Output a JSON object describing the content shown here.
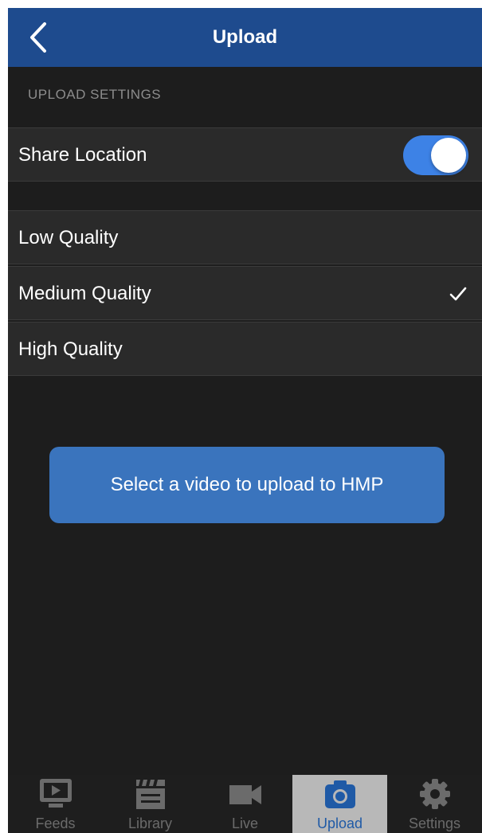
{
  "navbar": {
    "title": "Upload",
    "back_icon": "chevron-left-icon"
  },
  "section": {
    "header": "UPLOAD SETTINGS"
  },
  "share_location": {
    "label": "Share Location",
    "enabled": true
  },
  "quality": {
    "options": [
      {
        "label": "Low Quality",
        "selected": false
      },
      {
        "label": "Medium Quality",
        "selected": true
      },
      {
        "label": "High Quality",
        "selected": false
      }
    ]
  },
  "upload_button": {
    "label": "Select a video to upload to HMP"
  },
  "tabs": [
    {
      "label": "Feeds",
      "icon": "monitor-play-icon",
      "active": false
    },
    {
      "label": "Library",
      "icon": "clapperboard-icon",
      "active": false
    },
    {
      "label": "Live",
      "icon": "video-camera-icon",
      "active": false
    },
    {
      "label": "Upload",
      "icon": "camera-icon",
      "active": true
    },
    {
      "label": "Settings",
      "icon": "gear-icon",
      "active": false
    }
  ],
  "colors": {
    "navbar": "#1e4b8e",
    "accent": "#3d82e6",
    "button": "#3a74bd",
    "background": "#1d1d1d",
    "active_tab": "#b8b8b8",
    "active_tab_label": "#1f5aa6"
  }
}
